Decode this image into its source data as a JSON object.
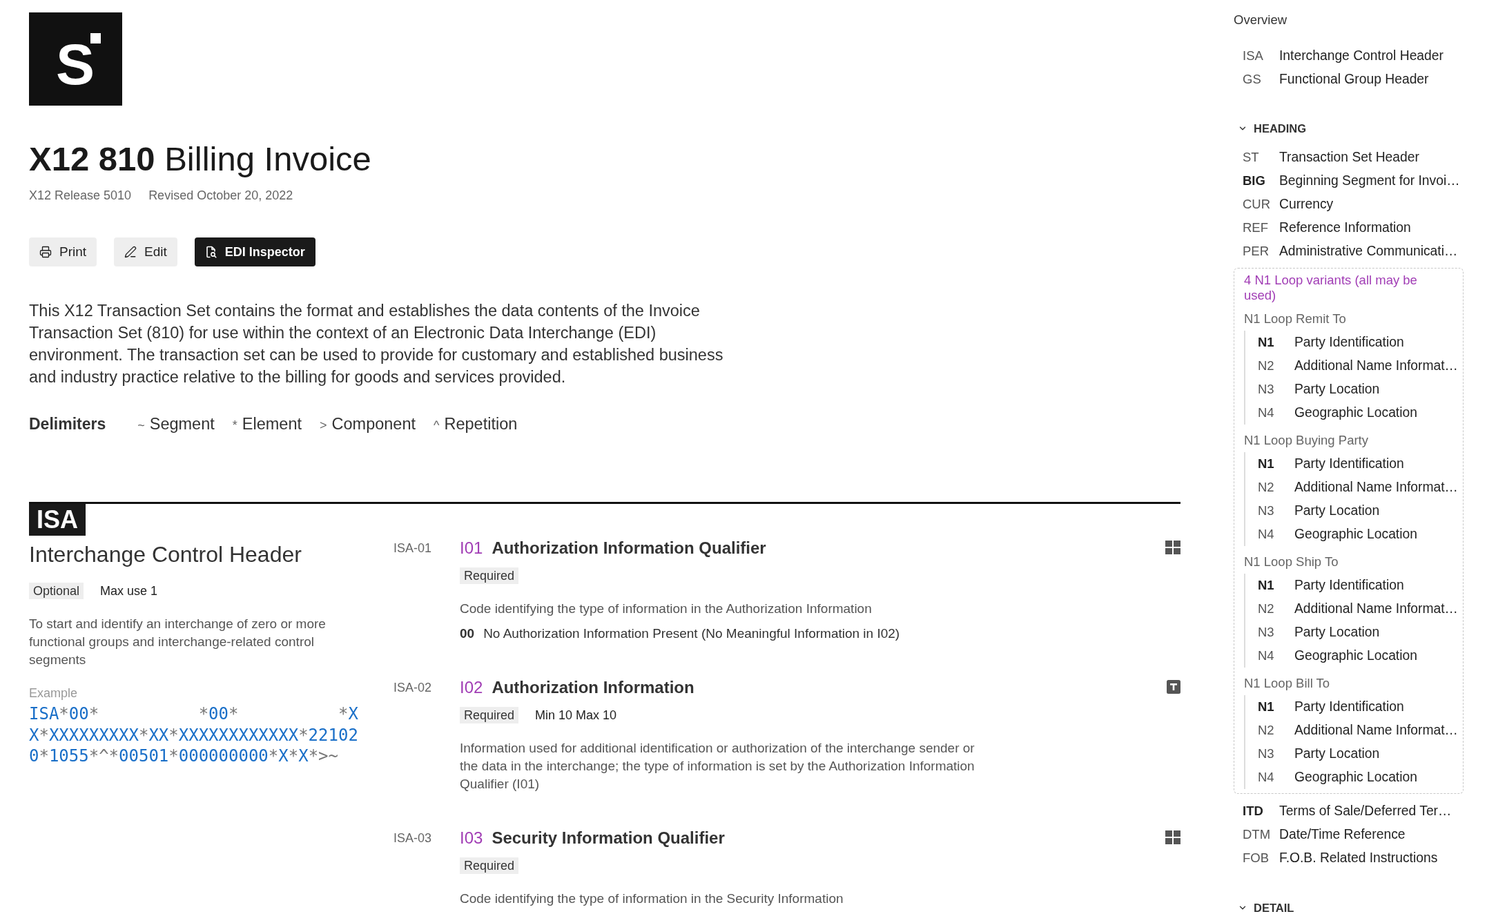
{
  "logo": {
    "text": "S"
  },
  "title": "**X12 810** Billing Invoice",
  "meta": [
    "X12 Release 5010",
    "Revised October 20, 2022"
  ],
  "actions": [
    {
      "label": "Print",
      "kind": "secondary"
    },
    {
      "label": "Edit",
      "kind": "secondary"
    },
    {
      "label": "EDI Inspector",
      "kind": "primary"
    }
  ],
  "description": "This X12 Transaction Set contains the format and establishes the data contents of the Invoice Transaction Set (810) for use within the context of an Electronic Data Interchange (EDI) environment. The transaction set can be used to provide for customary and established business and industry practice relative to the billing for goods and services provided.",
  "delimiters": {
    "label": "Delimiters",
    "items": [
      {
        "symbol": "~",
        "name": "Segment"
      },
      {
        "symbol": "*",
        "name": "Element"
      },
      {
        "symbol": ">",
        "name": "Component"
      },
      {
        "symbol": "^",
        "name": "Repetition"
      }
    ]
  },
  "segment": {
    "code": "ISA",
    "name": "Interchange Control Header",
    "usage": "Optional",
    "max_use": "Max use 1",
    "description": "To start and identify an interchange of zero or more functional groups and interchange-related control segments",
    "example_label": "Example",
    "example_lines": [
      [
        "ISA*00*",
        "*00*",
        "*X"
      ],
      [
        "X*XXXXXXXXX*XX*XXXXXXXXXXXX*22102"
      ],
      [
        "0*1055*^*00501*000000000*X*X*>~"
      ]
    ],
    "elements": [
      {
        "ref": "ISA-01",
        "id": "I01",
        "name": "Authorization Information Qualifier",
        "kind": "code",
        "usage": "Required",
        "description": "Code identifying the type of information in the Authorization Information",
        "codes": [
          {
            "value": "00",
            "meaning": "No Authorization Information Present (No Meaningful Information in I02)"
          }
        ]
      },
      {
        "ref": "ISA-02",
        "id": "I02",
        "name": "Authorization Information",
        "kind": "text",
        "usage": "Required",
        "length": "Min 10 Max 10",
        "description": "Information used for additional identification or authorization of the interchange sender or the data in the interchange; the type of information is set by the Authorization Information Qualifier (I01)"
      },
      {
        "ref": "ISA-03",
        "id": "I03",
        "name": "Security Information Qualifier",
        "kind": "code",
        "usage": "Required",
        "description": "Code identifying the type of information in the Security Information"
      }
    ]
  },
  "outline": {
    "title": "Overview",
    "items": [
      {
        "kind": "segment",
        "code": "ISA",
        "name": "Interchange Control Header",
        "required": false
      },
      {
        "kind": "segment",
        "code": "GS",
        "name": "Functional Group Header",
        "required": false
      }
    ],
    "sections": [
      {
        "label": "HEADING",
        "expanded": true,
        "items": [
          {
            "kind": "segment",
            "code": "ST",
            "name": "Transaction Set Header",
            "required": false
          },
          {
            "kind": "segment",
            "code": "BIG",
            "name": "Beginning Segment for Invoi…",
            "required": true
          },
          {
            "kind": "segment",
            "code": "CUR",
            "name": "Currency",
            "required": false
          },
          {
            "kind": "segment",
            "code": "REF",
            "name": "Reference Information",
            "required": false
          },
          {
            "kind": "segment",
            "code": "PER",
            "name": "Administrative Communicati…",
            "required": false
          },
          {
            "kind": "loop_group",
            "title": "4 N1 Loop variants (all may be used)",
            "loops": [
              {
                "name": "N1 Loop Remit To",
                "items": [
                  {
                    "code": "N1",
                    "name": "Party Identification",
                    "required": true
                  },
                  {
                    "code": "N2",
                    "name": "Additional Name Informat…",
                    "required": false
                  },
                  {
                    "code": "N3",
                    "name": "Party Location",
                    "required": false
                  },
                  {
                    "code": "N4",
                    "name": "Geographic Location",
                    "required": false
                  }
                ]
              },
              {
                "name": "N1 Loop Buying Party",
                "items": [
                  {
                    "code": "N1",
                    "name": "Party Identification",
                    "required": true
                  },
                  {
                    "code": "N2",
                    "name": "Additional Name Informat…",
                    "required": false
                  },
                  {
                    "code": "N3",
                    "name": "Party Location",
                    "required": false
                  },
                  {
                    "code": "N4",
                    "name": "Geographic Location",
                    "required": false
                  }
                ]
              },
              {
                "name": "N1 Loop Ship To",
                "items": [
                  {
                    "code": "N1",
                    "name": "Party Identification",
                    "required": true
                  },
                  {
                    "code": "N2",
                    "name": "Additional Name Informat…",
                    "required": false
                  },
                  {
                    "code": "N3",
                    "name": "Party Location",
                    "required": false
                  },
                  {
                    "code": "N4",
                    "name": "Geographic Location",
                    "required": false
                  }
                ]
              },
              {
                "name": "N1 Loop Bill To",
                "items": [
                  {
                    "code": "N1",
                    "name": "Party Identification",
                    "required": true
                  },
                  {
                    "code": "N2",
                    "name": "Additional Name Informat…",
                    "required": false
                  },
                  {
                    "code": "N3",
                    "name": "Party Location",
                    "required": false
                  },
                  {
                    "code": "N4",
                    "name": "Geographic Location",
                    "required": false
                  }
                ]
              }
            ]
          },
          {
            "kind": "segment",
            "code": "ITD",
            "name": "Terms of Sale/Deferred Ter…",
            "required": true
          },
          {
            "kind": "segment",
            "code": "DTM",
            "name": "Date/Time Reference",
            "required": false
          },
          {
            "kind": "segment",
            "code": "FOB",
            "name": "F.O.B. Related Instructions",
            "required": false
          }
        ]
      },
      {
        "label": "DETAIL",
        "expanded": true
      }
    ]
  }
}
